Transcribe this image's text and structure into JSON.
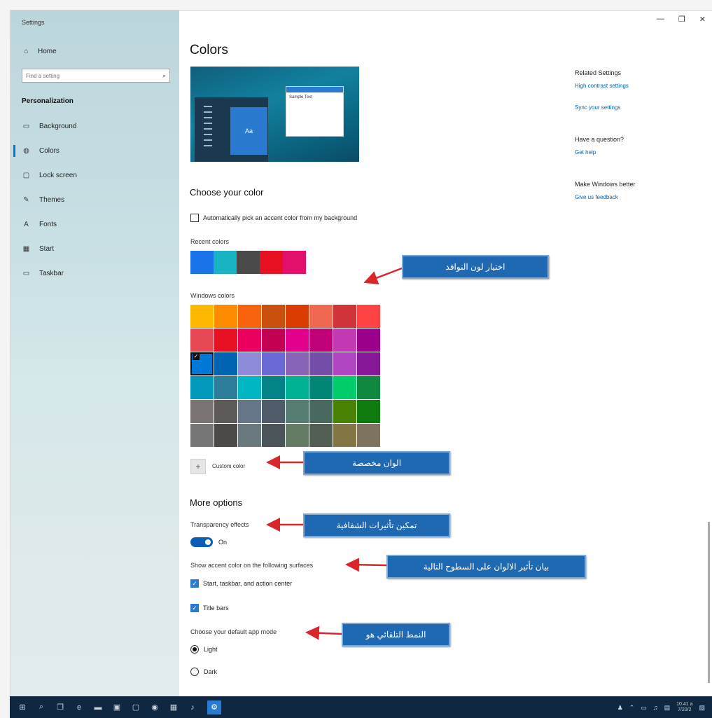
{
  "window": {
    "app_title": "Settings",
    "controls": {
      "minimize": "—",
      "maximize": "❐",
      "close": "✕"
    }
  },
  "sidebar": {
    "home_label": "Home",
    "search_placeholder": "Find a setting",
    "section_title": "Personalization",
    "items": [
      {
        "label": "Background",
        "icon": "picture-icon",
        "glyph": "▭",
        "active": false
      },
      {
        "label": "Colors",
        "icon": "palette-icon",
        "glyph": "◍",
        "active": true
      },
      {
        "label": "Lock screen",
        "icon": "lock-screen-icon",
        "glyph": "▢",
        "active": false
      },
      {
        "label": "Themes",
        "icon": "brush-icon",
        "glyph": "✎",
        "active": false
      },
      {
        "label": "Fonts",
        "icon": "font-icon",
        "glyph": "A",
        "active": false
      },
      {
        "label": "Start",
        "icon": "start-icon",
        "glyph": "▦",
        "active": false
      },
      {
        "label": "Taskbar",
        "icon": "taskbar-icon",
        "glyph": "▭",
        "active": false
      }
    ]
  },
  "main": {
    "title": "Colors",
    "preview": {
      "tile_text": "Aa",
      "window_text": "Sample Text"
    },
    "choose_color_title": "Choose your color",
    "auto_accent_label": "Automatically pick an accent color from my background",
    "recent_colors_label": "Recent colors",
    "recent_colors": [
      "#1a73e8",
      "#19b3c4",
      "#4a4a4a",
      "#e81123",
      "#e3106b"
    ],
    "windows_colors_label": "Windows colors",
    "windows_colors": [
      [
        "#ffb900",
        "#ff8c00",
        "#f7630c",
        "#ca5010",
        "#da3b01",
        "#ef6950",
        "#d13438",
        "#ff4343"
      ],
      [
        "#e74856",
        "#e81123",
        "#ea005e",
        "#c30052",
        "#e3008c",
        "#bf0077",
        "#c239b3",
        "#9a0089"
      ],
      [
        "#0078d7",
        "#0063b1",
        "#8e8cd8",
        "#6b69d6",
        "#8764b8",
        "#744da9",
        "#b146c2",
        "#881798"
      ],
      [
        "#0099bc",
        "#2d7d9a",
        "#00b7c3",
        "#038387",
        "#00b294",
        "#018574",
        "#00cc6a",
        "#10893e"
      ],
      [
        "#7a7574",
        "#5d5a58",
        "#68768a",
        "#515c6b",
        "#567c73",
        "#486860",
        "#498205",
        "#107c10"
      ],
      [
        "#767676",
        "#4c4a48",
        "#69797e",
        "#4a5459",
        "#647c64",
        "#525e54",
        "#847545",
        "#7e735f"
      ]
    ],
    "selected_color": "row 3, column 1",
    "custom_color_label": "Custom color",
    "more_options_title": "More options",
    "transparency_label": "Transparency effects",
    "transparency_state": "On",
    "accent_surfaces_label": "Show accent color on the following surfaces",
    "accent_start_label": "Start, taskbar, and action center",
    "accent_title_label": "Title bars",
    "app_mode_label": "Choose your default app mode",
    "mode_light": "Light",
    "mode_dark": "Dark"
  },
  "related": {
    "related_title": "Related Settings",
    "high_contrast": "High contrast settings",
    "sync": "Sync your settings",
    "question_title": "Have a question?",
    "get_help": "Get help",
    "better_title": "Make Windows better",
    "feedback": "Give us feedback"
  },
  "annotations": {
    "window_color": "اختيار لون النوافذ",
    "custom_colors": "الوان مخصصة",
    "transparency": "تمكين تأثيرات الشفافية",
    "surfaces": "بيان تأثير الالوان على السطوح التالية",
    "default_mode": "النمط التلقائي هو",
    "callout_color": "#1f69b3",
    "arrow_color": "#d8262b"
  },
  "taskbar": {
    "clock_time": "10:41 a",
    "clock_date": "7/20/2"
  }
}
